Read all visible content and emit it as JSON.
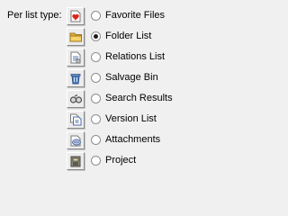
{
  "label": "Per list type:",
  "options": [
    {
      "label": "Favorite Files",
      "icon": "favorite-files-icon",
      "selected": false
    },
    {
      "label": "Folder List",
      "icon": "folder-icon",
      "selected": true
    },
    {
      "label": "Relations List",
      "icon": "relations-list-icon",
      "selected": false
    },
    {
      "label": "Salvage Bin",
      "icon": "salvage-bin-icon",
      "selected": false
    },
    {
      "label": "Search Results",
      "icon": "search-results-icon",
      "selected": false
    },
    {
      "label": "Version List",
      "icon": "version-list-icon",
      "selected": false
    },
    {
      "label": "Attachments",
      "icon": "attachments-icon",
      "selected": false
    },
    {
      "label": "Project",
      "icon": "project-icon",
      "selected": false
    }
  ]
}
